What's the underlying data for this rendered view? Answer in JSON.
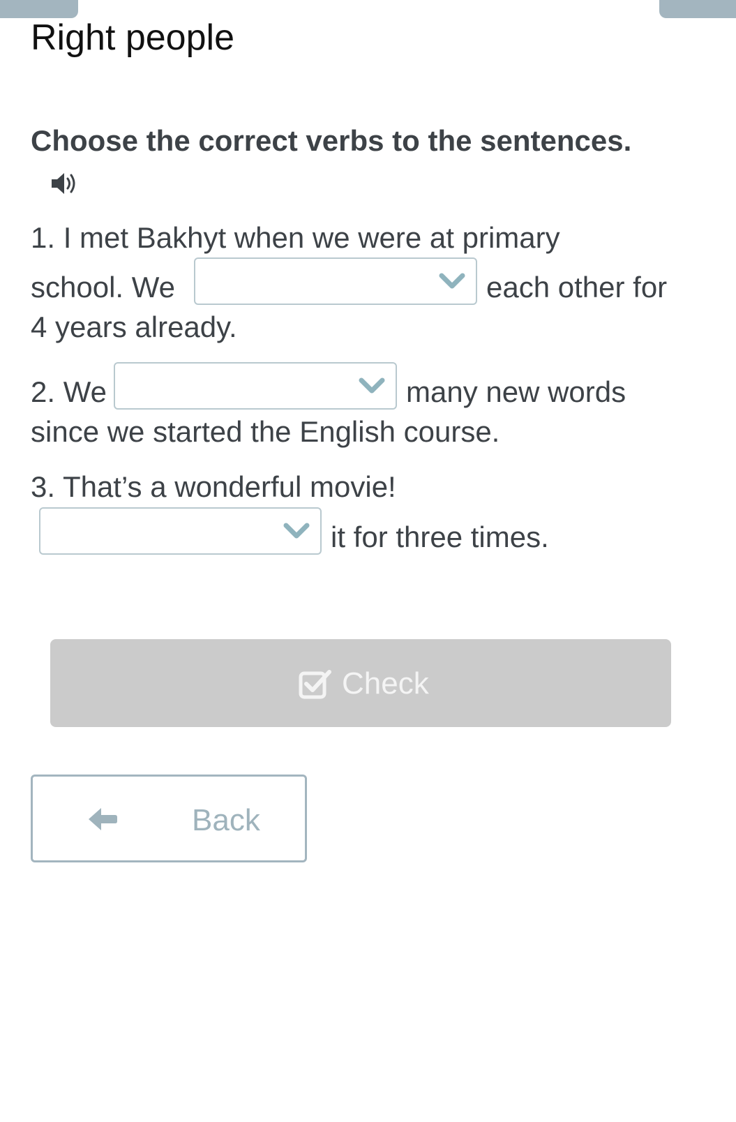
{
  "page": {
    "title": "Right people",
    "instruction": "Choose the correct verbs to the sentences.",
    "speaker_icon": "speaker-icon"
  },
  "sentences": [
    {
      "line1": "1. I met Bakhyt when we were at primary",
      "before": "school. We",
      "after": "each other for",
      "line3": "4 years already.",
      "selected": ""
    },
    {
      "before": "2. We",
      "after": "many new words",
      "line2": "since we started the English course.",
      "selected": ""
    },
    {
      "line1": "3. That’s a wonderful movie!",
      "after": "it for three times.",
      "selected": ""
    }
  ],
  "actions": {
    "check_label": "Check",
    "check_icon": "checkbox-check-icon",
    "back_label": "Back",
    "back_icon": "arrow-left-icon"
  },
  "colors": {
    "accent": "#a3b5bf",
    "chevron": "#8fb3bd",
    "check_bg": "#cbcbcb",
    "text": "#3d4247"
  }
}
